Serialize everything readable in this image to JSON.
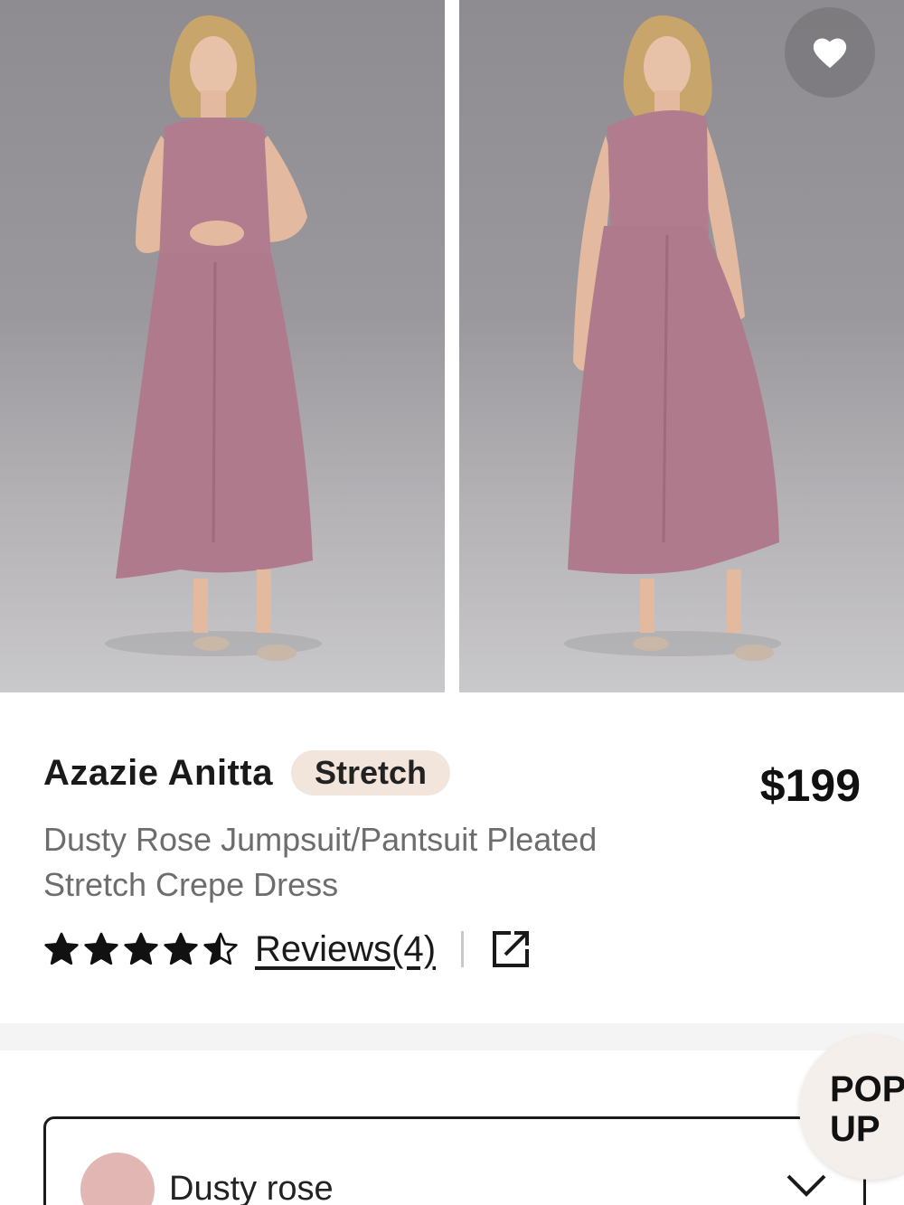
{
  "product": {
    "brand": "Azazie Anitta",
    "badge": "Stretch",
    "price": "$199",
    "description": "Dusty Rose Jumpsuit/Pantsuit Pleated Stretch Crepe Dress",
    "rating": 4.5,
    "rating_max": 5,
    "reviews_label": "Reviews(4)"
  },
  "gallery": {
    "images": [
      "dusty-rose-jumpsuit-front-smiling",
      "dusty-rose-jumpsuit-front-pose"
    ],
    "favorite_icon": "heart-icon"
  },
  "color_select": {
    "selected": "Dusty rose",
    "swatch_color": "#e2b7b3",
    "icon": "chevron-down-icon"
  },
  "popup": {
    "label": "POP UP"
  },
  "colors": {
    "garment": "#b27c8f",
    "badge_bg": "#f2e6dc",
    "text_secondary": "#6d6d6d"
  }
}
